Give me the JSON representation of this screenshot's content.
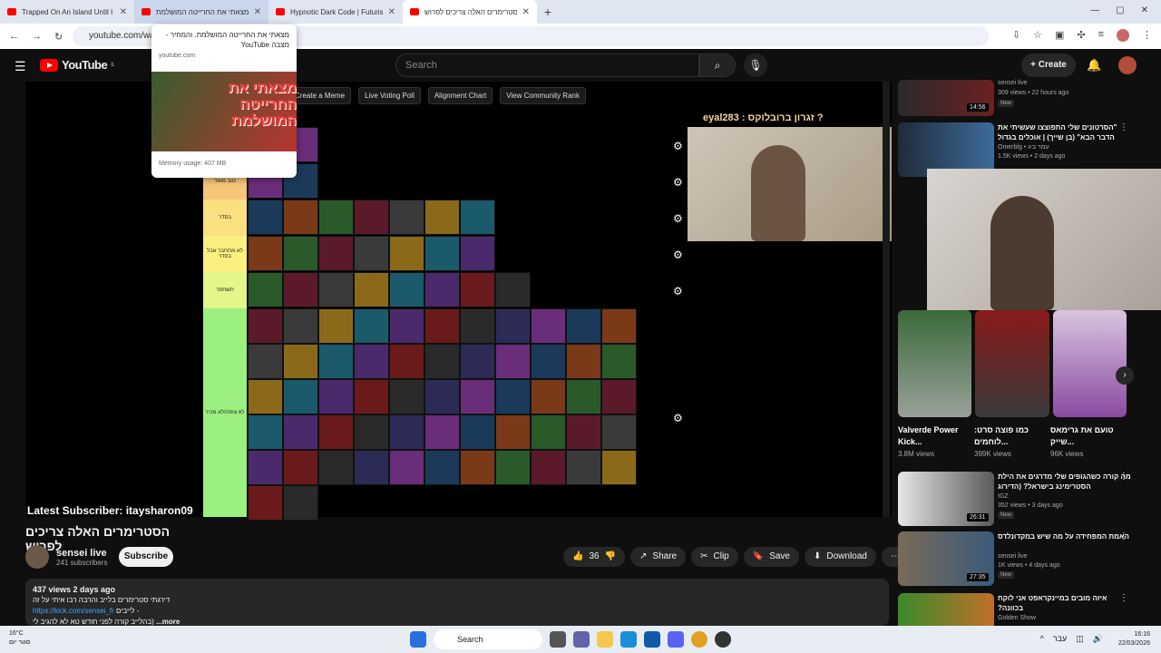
{
  "browser": {
    "tabs": [
      {
        "title": "Trapped On An Island Until I Bu"
      },
      {
        "title": "מצאתי את החרייטה המושלמת"
      },
      {
        "title": "Hypnotic Dark Code | Futuristic"
      },
      {
        "title": "הסטרימרים האלה צריכים לפרוש"
      }
    ],
    "new_tab": "+",
    "url": "youtube.com/wat"
  },
  "yt": {
    "logo_text": "YouTube",
    "region": "IL",
    "search_placeholder": "Search",
    "create_label": "Create"
  },
  "tab_preview": {
    "title": "מצאתי את החרייטה המושלמת. והמחיר - מצבה YouTube",
    "domain": "youtube.com",
    "thumb_text": "מצאתי את החרייטה המושלמת",
    "memory": "Memory usage: 407 MB"
  },
  "player": {
    "toolbar": [
      "Create a Meme",
      "Live Voting Poll",
      "Alignment Chart",
      "View Community Rank"
    ],
    "webcam_caption": "eyal283 : זגרון ברובלוקס ?",
    "latest_subscriber": "Latest Subscriber: itaysharon09",
    "tiers": [
      {
        "label": "",
        "color": "#f6c77a"
      },
      {
        "label": "טוב מאוד",
        "color": "#f6c77a"
      },
      {
        "label": "בסדר",
        "color": "#fbe07f"
      },
      {
        "label": "לא מתחבר אבל בסדר",
        "color": "#fbf07f"
      },
      {
        "label": "תשתפר",
        "color": "#e4f58a"
      },
      {
        "label": "לא צופה/לא מכיר",
        "color": "#9cf07f"
      }
    ]
  },
  "video": {
    "title": "הסטרימרים האלה צריכים לפרוש",
    "channel": "sensei live",
    "subs": "241 subscribers",
    "subscribe": "Subscribe",
    "likes": "36",
    "share": "Share",
    "clip": "Clip",
    "save": "Save",
    "download": "Download",
    "views_date": "437 views  2 days ago",
    "desc_line1": "דירגתי סטרימרים בלייב והרבה רבו איתי על זה",
    "desc_link": "https://kick.com/sensei_fr",
    "desc_link_suffix": "לייבים -",
    "desc_line3": "בהלייב קורה לפני חודש טא לא להגיב לי)",
    "more": "...more"
  },
  "related": [
    {
      "title": "",
      "channel": "sensei live",
      "views": "309 views • 22 hours ago",
      "badge": "New",
      "duration": "14:56"
    },
    {
      "title": "\"הסרטונים שלי התפוצצו שעשיתי את הדבר הבא\" (בן שייך) | אוכלים בגדול",
      "channel": "Omerblg • עמר ביג",
      "views": "1.5K views • 2 days ago",
      "duration": ""
    },
    {
      "title": "מה קורה כשהגופים שלי מדרגים את הילת הסטרימינג בישראל? (הדירוג",
      "channel": "IGZ",
      "views": "352 views • 3 days ago",
      "badge": "New",
      "duration": "26:31"
    },
    {
      "title": "האמת המפחידה על מה שיש במקדונלדס",
      "channel": "sensei live",
      "views": "1K views • 4 days ago",
      "badge": "New",
      "duration": "27:35"
    },
    {
      "title": "איזה מובים במיינקראפט אני לוקח בכוונה?",
      "channel": "Golden Show",
      "views": "",
      "duration": ""
    }
  ],
  "shorts": [
    {
      "title": "Valverde Power Kick...",
      "views": "3.8M views"
    },
    {
      "title": "כמו פוצה סרט: לוחמים...",
      "views": "399K views"
    },
    {
      "title": "טועם את גרימאס שייק...",
      "views": "96K views"
    }
  ],
  "taskbar": {
    "temp": "16°C",
    "weather": "סגור יום",
    "search": "Search",
    "lang": "עבר",
    "time": "16:16",
    "date": "22/03/2026"
  }
}
